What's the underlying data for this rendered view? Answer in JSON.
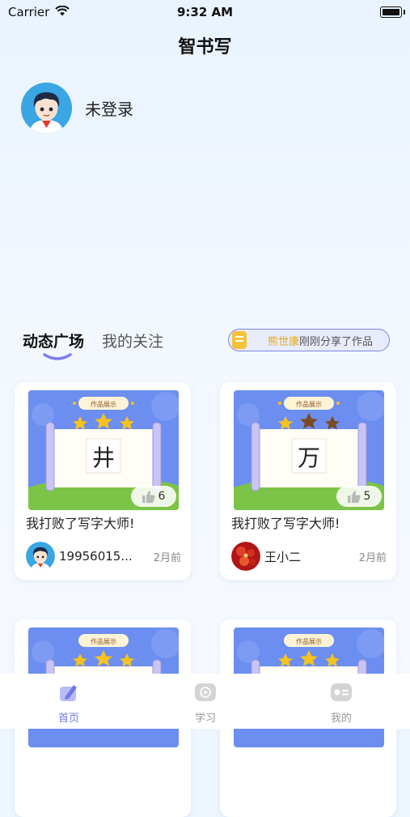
{
  "status_bar": {
    "carrier": "Carrier",
    "time": "9:32 AM"
  },
  "header": {
    "title": "智书写"
  },
  "profile": {
    "name": "未登录"
  },
  "tabs": [
    {
      "label": "动态广场",
      "active": true
    },
    {
      "label": "我的关注",
      "active": false
    }
  ],
  "notification": {
    "name": "熊世康",
    "text": "刚刚分享了作品"
  },
  "cards": [
    {
      "banner": "作品展示",
      "character": "井",
      "stars": 3,
      "likes": "6",
      "title": "我打败了写字大师!",
      "author": "19956015...",
      "time": "2月前"
    },
    {
      "banner": "作品展示",
      "character": "万",
      "stars": 1,
      "likes": "5",
      "title": "我打败了写字大师!",
      "author": "王小二",
      "time": "2月前"
    },
    {
      "banner": "作品展示",
      "stars": 3
    },
    {
      "banner": "作品展示",
      "stars": 3
    }
  ],
  "tabbar": [
    {
      "label": "首页",
      "icon": "pen-icon",
      "active": true
    },
    {
      "label": "学习",
      "icon": "play-icon",
      "active": false
    },
    {
      "label": "我的",
      "icon": "id-card-icon",
      "active": false
    }
  ],
  "colors": {
    "accent": "#6f7ae8",
    "notify_name": "#e4a820",
    "star_gold": "#f6c21f",
    "star_brown": "#7a4b22"
  }
}
